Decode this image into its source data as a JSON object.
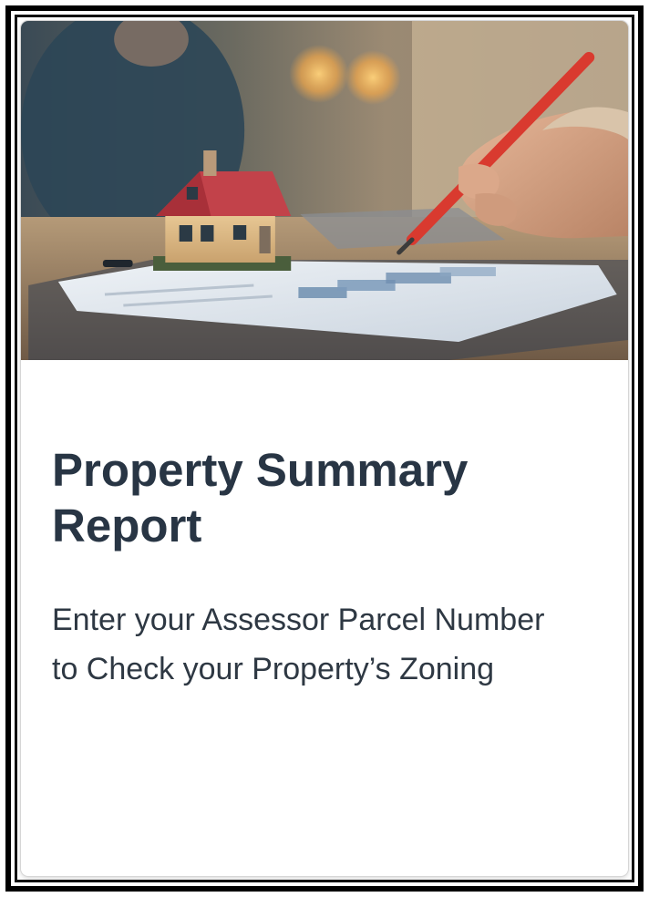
{
  "card": {
    "title": "Property Summary Report",
    "description": "Enter your Assessor Parcel Number to Check your Property’s Zoning"
  },
  "colors": {
    "title_text": "#283544",
    "body_text": "#2e3843",
    "frame_border": "#000000",
    "card_background": "#ffffff",
    "pencil": "#d93a2f",
    "house_roof": "#c2424a"
  },
  "icons": {
    "hero_image": "house-model-on-documents-with-red-pencil"
  }
}
